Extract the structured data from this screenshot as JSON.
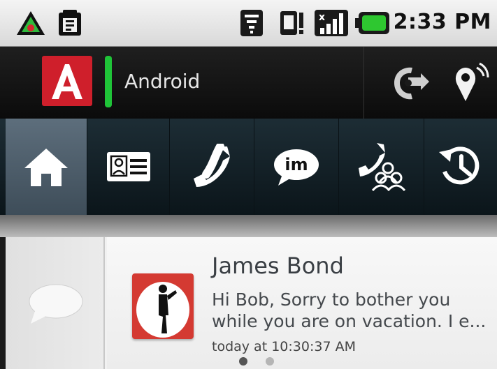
{
  "status_bar": {
    "time": "2:33 PM",
    "icons": [
      "app-notification-icon",
      "clipboard-icon",
      "wifi-icon",
      "sim-card-icon",
      "signal-icon",
      "battery-icon"
    ]
  },
  "header": {
    "app_logo_letter": "A",
    "presence_color": "#1fc438",
    "title": "Android",
    "action_icons": [
      "call-forward-icon",
      "location-icon"
    ]
  },
  "tabs": [
    {
      "name": "home",
      "icon": "home-icon",
      "active": true
    },
    {
      "name": "contacts",
      "icon": "contact-card-icon",
      "active": false
    },
    {
      "name": "phone",
      "icon": "phone-icon",
      "active": false
    },
    {
      "name": "im",
      "icon": "im-icon",
      "label": "im",
      "active": false
    },
    {
      "name": "conference",
      "icon": "conference-call-icon",
      "active": false
    },
    {
      "name": "history",
      "icon": "history-icon",
      "active": false
    }
  ],
  "notification": {
    "icon": "speech-bubble-icon",
    "sender": "James Bond",
    "message": "Hi Bob, Sorry to bother you while you are on vacation. I e...",
    "timestamp": "today at 10:30:37 AM",
    "page_count": 2,
    "current_page": 1
  },
  "colors": {
    "accent_red": "#cf1f2b",
    "active_tab": "#4f606d"
  }
}
